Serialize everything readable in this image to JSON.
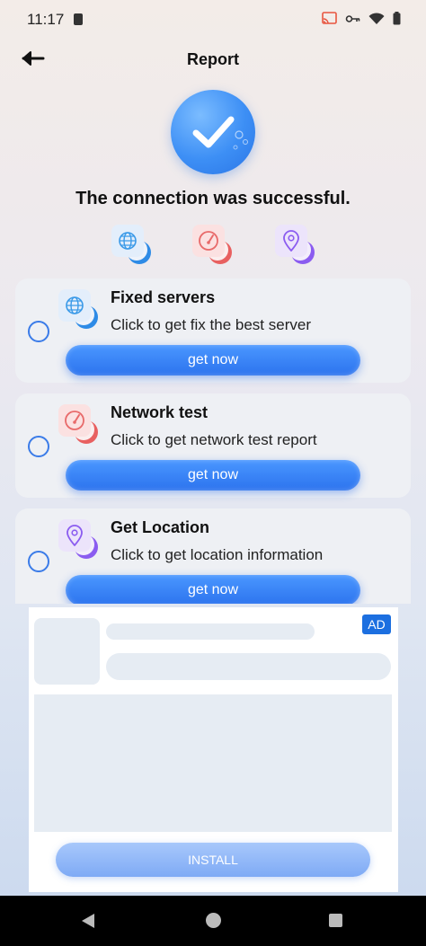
{
  "status_bar": {
    "time": "11:17"
  },
  "header": {
    "title": "Report"
  },
  "success": {
    "message": "The connection was successful."
  },
  "cards": [
    {
      "title": "Fixed servers",
      "desc": "Click to get fix the best server",
      "button": "get now",
      "icon": "globe-icon"
    },
    {
      "title": "Network test",
      "desc": "Click to get network test report",
      "button": "get now",
      "icon": "speedometer-icon"
    },
    {
      "title": "Get Location",
      "desc": "Click to get location information",
      "button": "get now",
      "icon": "location-pin-icon"
    }
  ],
  "ad": {
    "badge": "AD",
    "install_label": "INSTALL"
  },
  "colors": {
    "accent": "#2c73ee",
    "blue_icon": "#3b9ae8",
    "red_icon": "#e86a6a",
    "purple_icon": "#8b5cf0"
  }
}
